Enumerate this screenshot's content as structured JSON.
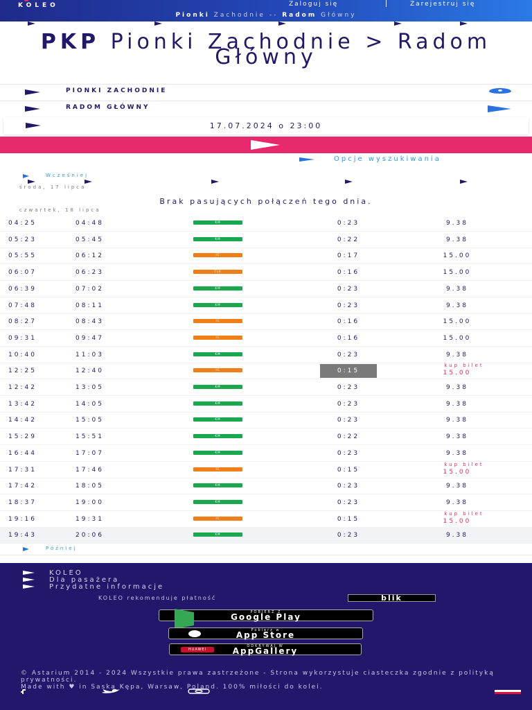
{
  "header": {
    "logo": "KOLEO",
    "login_label": "Zaloguj się",
    "register_label": "Zarejestruj się",
    "breadcrumb_from": "Pionki",
    "breadcrumb_from_rest": "Zachodnie",
    "breadcrumb_sep": "--",
    "breadcrumb_to": "Radom",
    "breadcrumb_to_rest": "Główny"
  },
  "title": {
    "brand": "PKP",
    "route": "Pionki Zachodnie > Radom Główny"
  },
  "search": {
    "from": "PIONKI ZACHODNIE",
    "to": "RADOM GŁÓWNY",
    "datetime": "17.07.2024 o 23:00",
    "options_label": "Opcje wyszukiwania"
  },
  "results": {
    "earlier_label": "Wcześniej",
    "later_label": "Później",
    "day1_label": "środa, 17 lipca",
    "no_match": "Brak pasujących połączeń tego dnia.",
    "day2_label": "czwartek, 18 lipca",
    "buy_label": "kup bilet",
    "colors": {
      "KM": "#1aa84f",
      "IC": "#f07f1a",
      "TLK": "#f07f1a"
    },
    "rows": [
      {
        "dep": "04:25",
        "arr": "04:48",
        "carrier": "KM",
        "dur": "0:23",
        "price": "9.38",
        "buy": false
      },
      {
        "dep": "05:23",
        "arr": "05:45",
        "carrier": "KM",
        "dur": "0:22",
        "price": "9.38",
        "buy": false
      },
      {
        "dep": "05:55",
        "arr": "06:12",
        "carrier": "IC",
        "dur": "0:17",
        "price": "15.00",
        "buy": false
      },
      {
        "dep": "06:07",
        "arr": "06:23",
        "carrier": "TLK",
        "dur": "0:16",
        "price": "15.00",
        "buy": false
      },
      {
        "dep": "06:39",
        "arr": "07:02",
        "carrier": "KM",
        "dur": "0:23",
        "price": "9.38",
        "buy": false
      },
      {
        "dep": "07:48",
        "arr": "08:11",
        "carrier": "KM",
        "dur": "0:23",
        "price": "9.38",
        "buy": false
      },
      {
        "dep": "08:27",
        "arr": "08:43",
        "carrier": "IC",
        "dur": "0:16",
        "price": "15.00",
        "buy": false
      },
      {
        "dep": "09:31",
        "arr": "09:47",
        "carrier": "IC",
        "dur": "0:16",
        "price": "15.00",
        "buy": false
      },
      {
        "dep": "10:40",
        "arr": "11:03",
        "carrier": "KM",
        "dur": "0:23",
        "price": "9.38",
        "buy": false
      },
      {
        "dep": "12:25",
        "arr": "12:40",
        "carrier": "IC",
        "dur": "0:15",
        "price": "15.00",
        "buy": true,
        "highlight": true
      },
      {
        "dep": "12:42",
        "arr": "13:05",
        "carrier": "KM",
        "dur": "0:23",
        "price": "9.38",
        "buy": false
      },
      {
        "dep": "13:42",
        "arr": "14:05",
        "carrier": "KM",
        "dur": "0:23",
        "price": "9.38",
        "buy": false
      },
      {
        "dep": "14:42",
        "arr": "15:05",
        "carrier": "KM",
        "dur": "0:23",
        "price": "9.38",
        "buy": false
      },
      {
        "dep": "15:29",
        "arr": "15:51",
        "carrier": "KM",
        "dur": "0:22",
        "price": "9.38",
        "buy": false
      },
      {
        "dep": "16:44",
        "arr": "17:07",
        "carrier": "KM",
        "dur": "0:23",
        "price": "9.38",
        "buy": false
      },
      {
        "dep": "17:31",
        "arr": "17:46",
        "carrier": "IC",
        "dur": "0:15",
        "price": "15.00",
        "buy": true
      },
      {
        "dep": "17:42",
        "arr": "18:05",
        "carrier": "KM",
        "dur": "0:23",
        "price": "9.38",
        "buy": false
      },
      {
        "dep": "18:37",
        "arr": "19:00",
        "carrier": "KM",
        "dur": "0:23",
        "price": "9.38",
        "buy": false
      },
      {
        "dep": "19:16",
        "arr": "19:31",
        "carrier": "IC",
        "dur": "0:15",
        "price": "15.00",
        "buy": true
      },
      {
        "dep": "19:43",
        "arr": "20:06",
        "carrier": "KM",
        "dur": "0:23",
        "price": "9.38",
        "buy": false,
        "alt": true
      }
    ]
  },
  "footer": {
    "links": [
      "KOLEO",
      "Dla pasażera",
      "Przydatne informacje"
    ],
    "payment_text": "KOLEO rekomenduje płatność",
    "blik": "blik",
    "google_small": "POBIERZ Z",
    "google_big": "Google Play",
    "apple_small": "Pobierz w",
    "apple_big": "App Store",
    "huawei_small": "ODKRYWAJ W",
    "huawei_badge": "HUAWEI",
    "huawei_big": "AppGallery",
    "copyright": "© Astarium 2014 - 2024 Wszystkie prawa zastrzeżone - Strona wykorzystuje ciasteczka zgodnie z polityką prywatności.",
    "made_with": "Made with ♥ in Saska Kępa, Warsaw, Poland. 100% miłości do kolei.",
    "social_icons": [
      "facebook-icon",
      "twitter-icon",
      "instagram-icon"
    ]
  }
}
